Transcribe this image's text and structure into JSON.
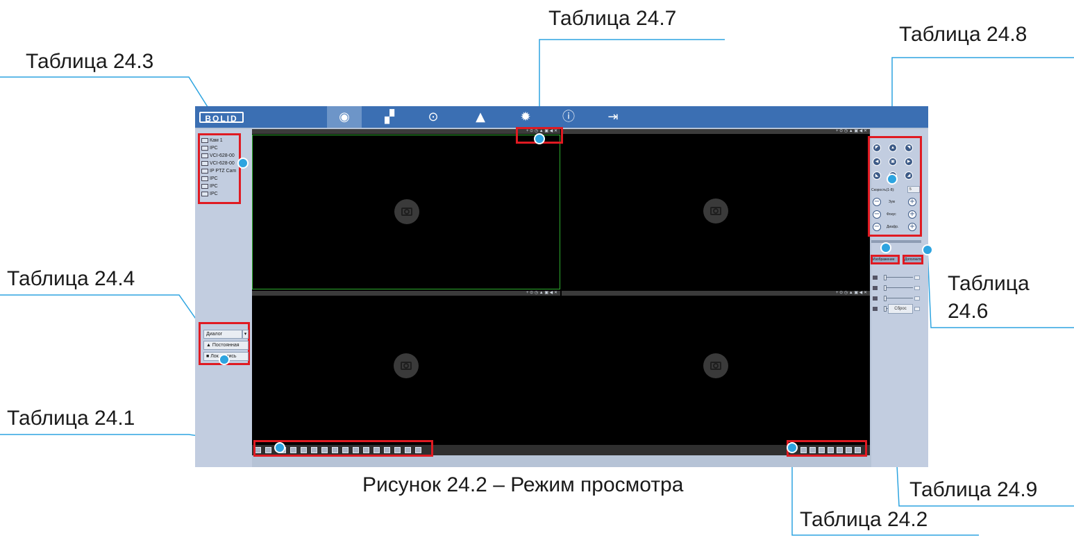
{
  "callouts": {
    "t247": "Таблица 24.7",
    "t248": "Таблица 24.8",
    "t243": "Таблица 24.3",
    "t244": "Таблица 24.4",
    "t246_line1": "Таблица",
    "t246_line2": "24.6",
    "t241": "Таблица 24.1",
    "t249": "Таблица 24.9",
    "t242": "Таблица 24.2"
  },
  "caption": "Рисунок 24.2 – Режим просмотра",
  "app": {
    "logo": "BOLID",
    "nav": [
      {
        "icon": "eye-icon",
        "glyph": "◉",
        "active": true
      },
      {
        "icon": "playback-icon",
        "glyph": "▞"
      },
      {
        "icon": "target-icon",
        "glyph": "⊙"
      },
      {
        "icon": "alarm-icon",
        "glyph": "▲"
      },
      {
        "icon": "settings-icon",
        "glyph": "✹"
      },
      {
        "icon": "info-icon",
        "glyph": "ⓘ"
      },
      {
        "icon": "logout-icon",
        "glyph": "⇥"
      }
    ],
    "channels": [
      "Кам 1",
      "IPC",
      "VCI-628-00",
      "VCI-628-00",
      "IP PTZ Cam",
      "IPC",
      "IPC",
      "IPC"
    ],
    "controls": {
      "stream_select": "Диалог",
      "talk_button": "Постоянная",
      "record_button": "Лок. запись"
    },
    "tile_tools": "+ ⊙ ◷ ▲ ▣ ◀ ✕",
    "ptz": {
      "speed_label": "Скорость(1-8):",
      "speed_value": "5",
      "zoom_label": "Зум",
      "focus_label": "Фокус",
      "iris_label": "Диафр."
    },
    "tabs": {
      "left": "Изображение",
      "right": "Дополнительно"
    },
    "reset_button": "Сброс",
    "colors": {
      "topbar": "#3b6fb3",
      "panel": "#c2cde0",
      "highlight": "#e01a22",
      "marker": "#2da4e0"
    }
  }
}
